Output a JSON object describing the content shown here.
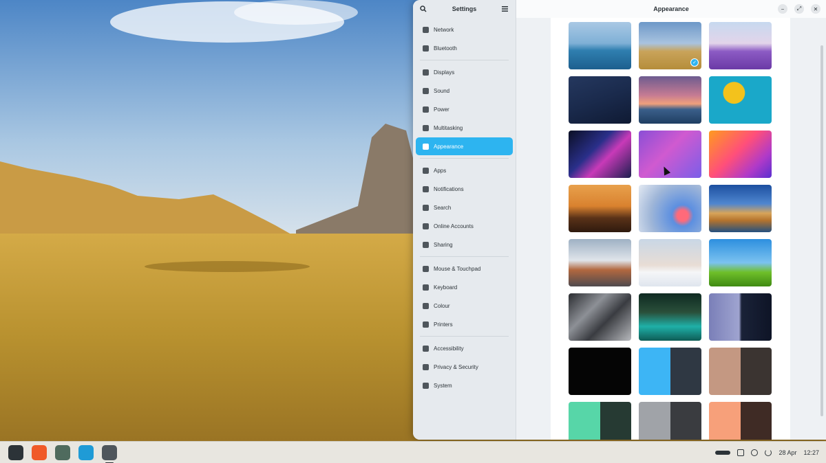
{
  "settings": {
    "title": "Settings",
    "menu_icon": "hamburger-menu-icon",
    "search_icon": "search-icon",
    "accent_color": "#2db4f0",
    "groups": [
      [
        {
          "label": "Network",
          "icon": "network-icon"
        },
        {
          "label": "Bluetooth",
          "icon": "bluetooth-icon"
        }
      ],
      [
        {
          "label": "Displays",
          "icon": "display-icon"
        },
        {
          "label": "Sound",
          "icon": "sound-icon"
        },
        {
          "label": "Power",
          "icon": "power-icon"
        },
        {
          "label": "Multitasking",
          "icon": "multitasking-icon"
        },
        {
          "label": "Appearance",
          "icon": "appearance-icon",
          "active": true
        }
      ],
      [
        {
          "label": "Apps",
          "icon": "apps-icon"
        },
        {
          "label": "Notifications",
          "icon": "bell-icon"
        },
        {
          "label": "Search",
          "icon": "search-icon"
        },
        {
          "label": "Online Accounts",
          "icon": "accounts-icon"
        },
        {
          "label": "Sharing",
          "icon": "share-icon"
        }
      ],
      [
        {
          "label": "Mouse & Touchpad",
          "icon": "mouse-icon"
        },
        {
          "label": "Keyboard",
          "icon": "keyboard-icon"
        },
        {
          "label": "Colour",
          "icon": "colour-icon"
        },
        {
          "label": "Printers",
          "icon": "printer-icon"
        }
      ],
      [
        {
          "label": "Accessibility",
          "icon": "accessibility-icon"
        },
        {
          "label": "Privacy & Security",
          "icon": "privacy-icon"
        },
        {
          "label": "System",
          "icon": "gear-icon"
        }
      ]
    ]
  },
  "appearance": {
    "title": "Appearance",
    "controls": {
      "minimize": "−",
      "maximize": "⤢",
      "close": "✕"
    },
    "selected_index": 1,
    "wallpapers": [
      {
        "name": "island-sea",
        "bg": "linear-gradient(180deg,#a9c8e4 0%,#7fb0d6 45%,#2f7fb0 60%,#1d5f8e 100%)"
      },
      {
        "name": "mesa-field",
        "bg": "linear-gradient(180deg,#6d98c8 0%,#a9c3df 45%,#c9a35a 62%,#b58d3a 100%)"
      },
      {
        "name": "lavender-tree",
        "bg": "linear-gradient(180deg,#c7d9ef 0%,#e2d4ea 45%,#8c5bc4 62%,#6b3aa6 100%)"
      },
      {
        "name": "dark-dunes",
        "bg": "linear-gradient(160deg,#25385f 0%,#1a2a4c 50%,#0f1a33 100%)"
      },
      {
        "name": "pink-clouds-sea",
        "bg": "linear-gradient(180deg,#6d5b8f 0%,#c57b93 40%,#f0a07c 58%,#3b5f8a 70%,#1f3e62 100%)"
      },
      {
        "name": "pool-float",
        "bg": "radial-gradient(circle at 40% 35%,#f3c21c 0 22%,#1aa8c9 23% 100%)"
      },
      {
        "name": "crystal-abstract",
        "bg": "linear-gradient(135deg,#0b0f24 0%,#2a2f8a 40%,#c83ab8 60%,#1c1f4f 100%)"
      },
      {
        "name": "purple-waves",
        "bg": "linear-gradient(135deg,#8a4fd6 0%,#d05ad0 45%,#7a5ee8 100%)"
      },
      {
        "name": "sunset-gradient",
        "bg": "linear-gradient(135deg,#ff9a1f 0%,#ff4f7a 45%,#b03ac8 75%,#5a2fd0 100%)"
      },
      {
        "name": "sugarloaf-sunset",
        "bg": "linear-gradient(180deg,#e8a14c 0%,#d9822f 45%,#5a3218 70%,#2e1a0e 100%)"
      },
      {
        "name": "blue-glass",
        "bg": "radial-gradient(circle at 70% 65%,#ff6a7a 0 10%,#5c8fe0 20%,#9fb6d8 60%,#e3e9f2 100%)"
      },
      {
        "name": "blue-rocks-lake",
        "bg": "linear-gradient(180deg,#1c4fa0 0%,#4f86cf 40%,#d7a45a 60%,#b5742d 75%,#245080 100%)"
      },
      {
        "name": "snow-rocks",
        "bg": "linear-gradient(180deg,#9fb1c4 0%,#dfe4ea 45%,#b2683f 65%,#4f4a4e 100%)"
      },
      {
        "name": "frosted-tree",
        "bg": "linear-gradient(180deg,#c9d7e6 0%,#e8ddd5 55%,#f5f6f8 70%,#dfe5ee 100%)"
      },
      {
        "name": "green-field-sky",
        "bg": "linear-gradient(180deg,#2d8fdf 0%,#7bc2f0 50%,#6fbf2a 70%,#3f8a12 100%)"
      },
      {
        "name": "grey-squares",
        "bg": "linear-gradient(135deg,#2b2d31 0%,#8d9096 35%,#3a3c41 60%,#b7b9bd 100%)"
      },
      {
        "name": "tropical-lagoon",
        "bg": "linear-gradient(180deg,#0f2a22 0%,#2a4f3a 40%,#1fb0a8 70%,#0e5c55 100%)"
      },
      {
        "name": "mountain-night-split",
        "bg": "linear-gradient(90deg,#7a7fb8 0%,#9fa4d0 48%,#1a2238 52%,#0e1426 100%)"
      },
      {
        "name": "solid-black",
        "bg": "#050505"
      },
      {
        "name": "sky-blue-slate",
        "split": [
          "#3db5f5",
          "#2f3843"
        ]
      },
      {
        "name": "tan-dark",
        "split": [
          "#c49882",
          "#3b3431"
        ]
      },
      {
        "name": "mint-dark",
        "split": [
          "#57d6a8",
          "#263a33"
        ]
      },
      {
        "name": "grey-charcoal",
        "split": [
          "#a0a3a8",
          "#3a3c40"
        ]
      },
      {
        "name": "peach-brown",
        "split": [
          "#f7a07a",
          "#3f2b25"
        ]
      }
    ]
  },
  "taskbar": {
    "apps": [
      {
        "name": "zorin-menu-icon",
        "color": "#2c3338"
      },
      {
        "name": "brave-browser-icon",
        "color": "#f05a28"
      },
      {
        "name": "files-icon",
        "color": "#4f6b5e"
      },
      {
        "name": "software-store-icon",
        "color": "#1f9bd6"
      },
      {
        "name": "settings-gear-icon",
        "color": "#4f565c",
        "active": true
      }
    ],
    "date": "28 Apr",
    "time": "12:27"
  }
}
